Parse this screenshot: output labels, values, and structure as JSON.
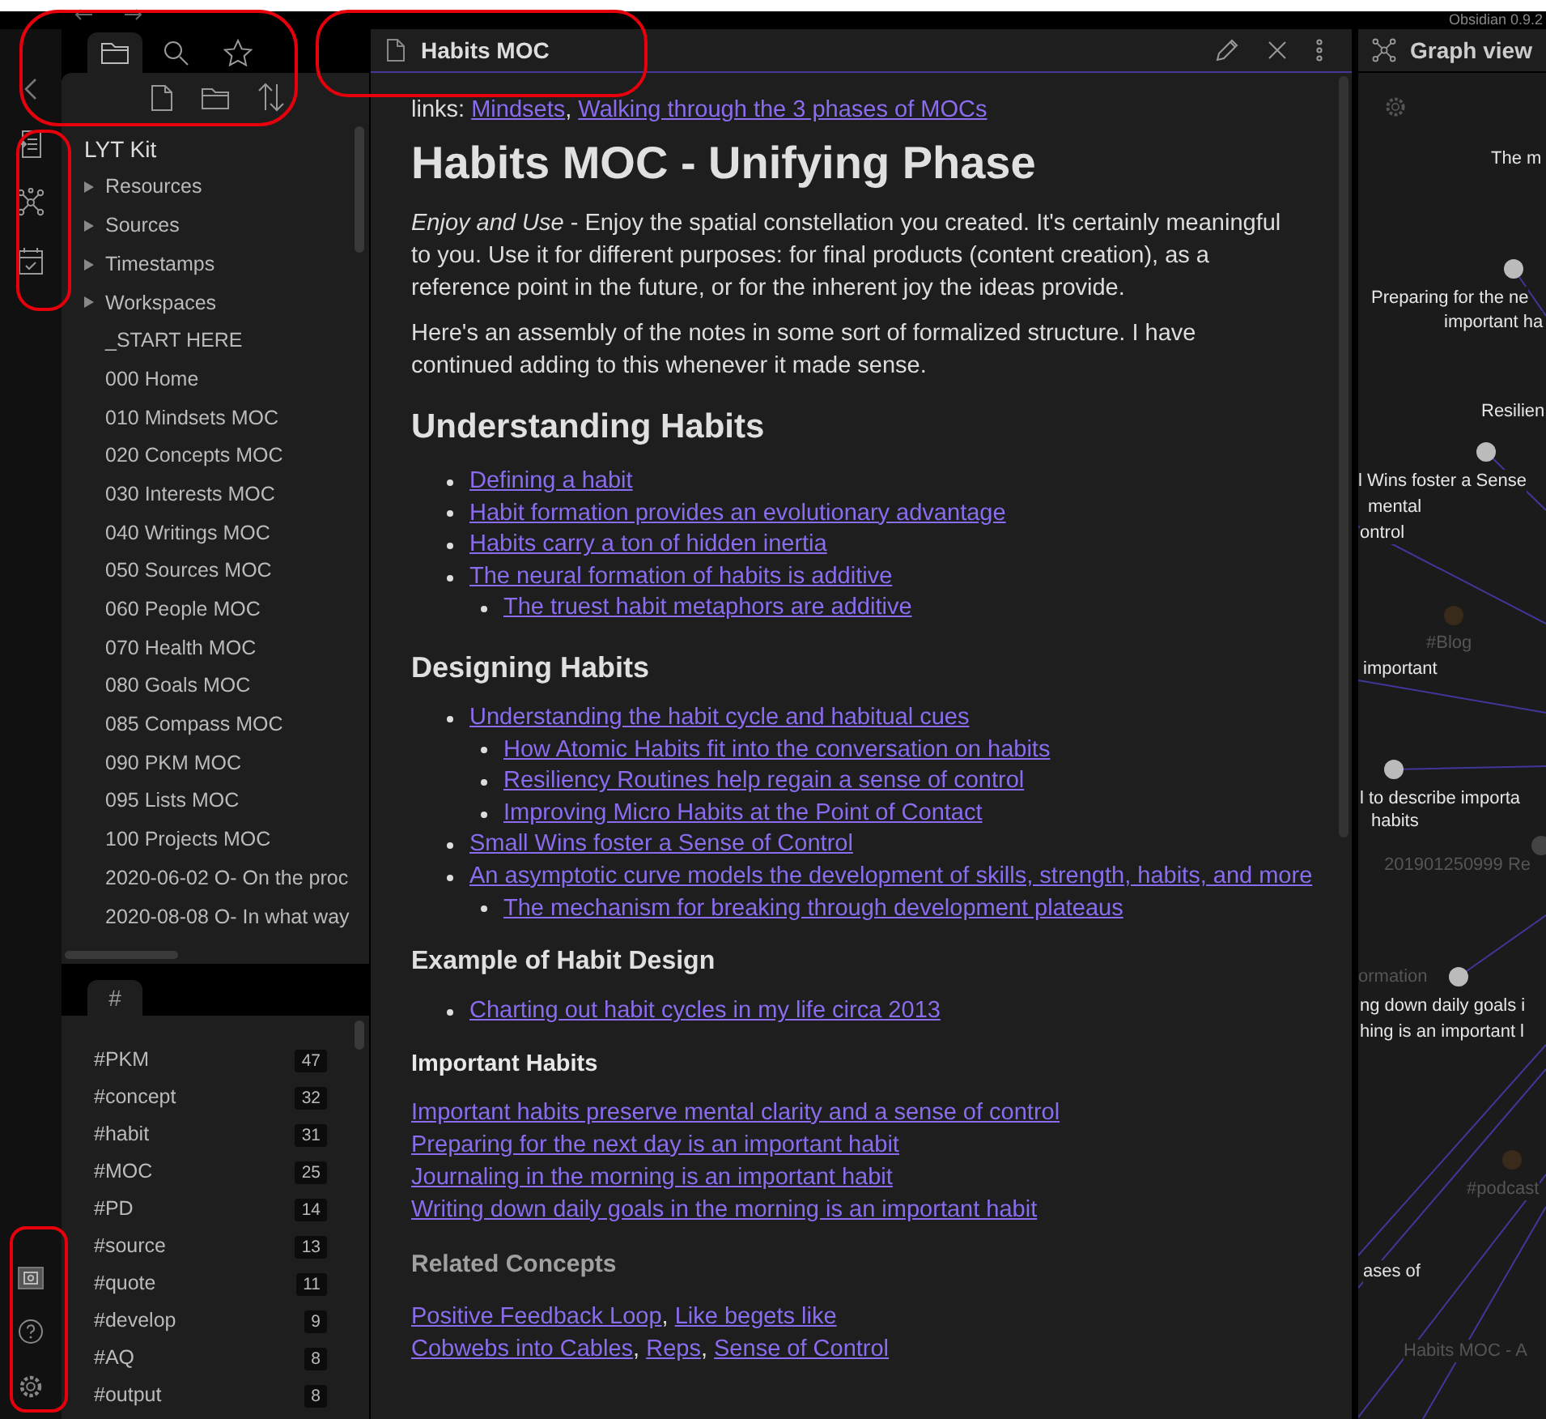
{
  "app_title": "Obsidian 0.9.2",
  "sidebar": {
    "tabs": [
      {
        "selected": true
      },
      {
        "selected": false
      },
      {
        "selected": false
      }
    ],
    "vault": "LYT Kit",
    "items": [
      {
        "kind": "folder",
        "label": "Resources",
        "expanded": false
      },
      {
        "kind": "folder",
        "label": "Sources",
        "expanded": false
      },
      {
        "kind": "folder",
        "label": "Timestamps",
        "expanded": false
      },
      {
        "kind": "folder",
        "label": "Workspaces",
        "expanded": false
      },
      {
        "kind": "file",
        "label": "_START HERE"
      },
      {
        "kind": "file",
        "label": "000 Home"
      },
      {
        "kind": "file",
        "label": "010 Mindsets MOC"
      },
      {
        "kind": "file",
        "label": "020 Concepts MOC"
      },
      {
        "kind": "file",
        "label": "030 Interests MOC"
      },
      {
        "kind": "file",
        "label": "040 Writings MOC"
      },
      {
        "kind": "file",
        "label": "050 Sources MOC"
      },
      {
        "kind": "file",
        "label": "060 People MOC"
      },
      {
        "kind": "file",
        "label": "070 Health MOC"
      },
      {
        "kind": "file",
        "label": "080 Goals MOC"
      },
      {
        "kind": "file",
        "label": "085 Compass MOC"
      },
      {
        "kind": "file",
        "label": "090 PKM MOC"
      },
      {
        "kind": "file",
        "label": "095 Lists MOC"
      },
      {
        "kind": "file",
        "label": "100 Projects MOC"
      },
      {
        "kind": "file",
        "label": "2020-06-02 O- On the proc"
      },
      {
        "kind": "file",
        "label": "2020-08-08 O- In what way"
      }
    ]
  },
  "tags_panel": {
    "tab": "#",
    "tags": [
      {
        "name": "#PKM",
        "count": "47"
      },
      {
        "name": "#concept",
        "count": "32"
      },
      {
        "name": "#habit",
        "count": "31"
      },
      {
        "name": "#MOC",
        "count": "25"
      },
      {
        "name": "#PD",
        "count": "14"
      },
      {
        "name": "#source",
        "count": "13"
      },
      {
        "name": "#quote",
        "count": "11"
      },
      {
        "name": "#develop",
        "count": "9"
      },
      {
        "name": "#AQ",
        "count": "8"
      },
      {
        "name": "#output",
        "count": "8"
      }
    ]
  },
  "note": {
    "title": "Habits MOC",
    "blocks": [
      {
        "kind": "links",
        "label": "links:",
        "separator": ",",
        "items": [
          "Mindsets",
          "Walking through the 3 phases of MOCs"
        ]
      },
      {
        "kind": "h1",
        "text": "Habits MOC - Unifying Phase"
      },
      {
        "kind": "paragraph",
        "text": "*Enjoy and Use* - Enjoy the spatial constellation you created. It's certainly meaningful to you. Use it for different purposes: for final products (content creation), as a reference point in the future, or for the inherent joy the ideas provide."
      },
      {
        "kind": "paragraph",
        "text": "Here's an assembly of the notes in some sort of formalized structure. I have continued adding to this whenever it made sense."
      },
      {
        "kind": "h2",
        "text": "Understanding Habits"
      },
      {
        "kind": "list",
        "items": [
          {
            "text": "Defining a habit"
          },
          {
            "text": "Habit formation provides an evolutionary advantage"
          },
          {
            "text": "Habits carry a ton of hidden inertia"
          },
          {
            "text": "The neural formation of habits is additive",
            "children": [
              {
                "text": "The truest habit metaphors are additive"
              }
            ]
          }
        ]
      },
      {
        "kind": "h3",
        "text": "Designing Habits"
      },
      {
        "kind": "list",
        "items": [
          {
            "text": "Understanding the habit cycle and habitual cues",
            "children": [
              {
                "text": "How Atomic Habits fit into the conversation on habits"
              },
              {
                "text": "Resiliency Routines help regain a sense of control"
              },
              {
                "text": "Improving Micro Habits at the Point of Contact"
              }
            ]
          },
          {
            "text": "Small Wins foster a Sense of Control"
          },
          {
            "text": "An asymptotic curve models the development of skills, strength, habits, and more",
            "children": [
              {
                "text": "The mechanism for breaking through development plateaus"
              }
            ]
          }
        ]
      },
      {
        "kind": "h4",
        "text": "Example of Habit Design"
      },
      {
        "kind": "list",
        "items": [
          {
            "text": "Charting out habit cycles in my life circa 2013"
          }
        ]
      },
      {
        "kind": "h5",
        "text": "Important Habits"
      },
      {
        "kind": "link_lines",
        "lines": [
          [
            "Important habits preserve mental clarity and a sense of control"
          ],
          [
            "Preparing for the next day is an important habit"
          ],
          [
            "Journaling in the morning is an important habit"
          ],
          [
            "Writing down daily goals in the morning is an important habit"
          ]
        ]
      },
      {
        "kind": "h6",
        "text": "Related Concepts"
      },
      {
        "kind": "link_lines",
        "separator": ",",
        "lines": [
          [
            "Positive Feedback Loop",
            "Like begets like"
          ],
          [
            "Cobwebs into Cables",
            "Reps",
            "Sense of Control"
          ]
        ]
      }
    ]
  },
  "graph": {
    "title": "Graph view",
    "labels": [
      {
        "text": "The m",
        "dim": false
      },
      {
        "text": "Preparing for the ne",
        "dim": false
      },
      {
        "text": "important ha",
        "dim": false
      },
      {
        "text": "Resilien",
        "dim": false
      },
      {
        "text": "l Wins foster a Sense",
        "dim": false
      },
      {
        "text": "mental",
        "dim": false
      },
      {
        "text": "ontrol",
        "dim": false
      },
      {
        "text": "#Blog",
        "dim": true
      },
      {
        "text": "important",
        "dim": false
      },
      {
        "text": "l to describe importa",
        "dim": false
      },
      {
        "text": "habits",
        "dim": false
      },
      {
        "text": "201901250999 Re",
        "dim": true
      },
      {
        "text": "ormation",
        "dim": true
      },
      {
        "text": "ng down daily goals i",
        "dim": false
      },
      {
        "text": "hing is an important l",
        "dim": false
      },
      {
        "text": "#podcast",
        "dim": true
      },
      {
        "text": "ases of",
        "dim": false
      },
      {
        "text": "Habits MOC - A",
        "dim": true
      }
    ]
  }
}
